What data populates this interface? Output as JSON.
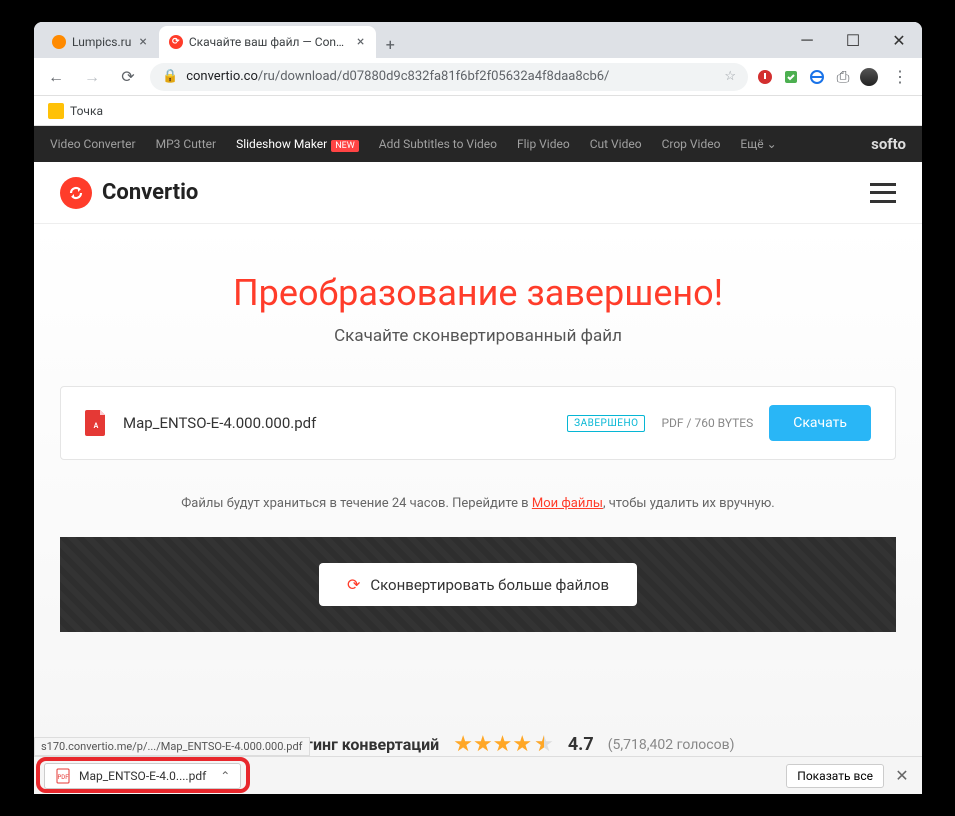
{
  "tabs": [
    {
      "title": "Lumpics.ru"
    },
    {
      "title": "Скачайте ваш файл — Convertio"
    }
  ],
  "url": {
    "host": "convertio.co",
    "path": "/ru/download/d07880d9c832fa81f6bf2f05632a4f8daa8cb6/"
  },
  "bookmark": "Точка",
  "softo_nav": {
    "items": [
      "Video Converter",
      "MP3 Cutter",
      "Slideshow Maker",
      "Add Subtitles to Video",
      "Flip Video",
      "Cut Video",
      "Crop Video",
      "Ещё"
    ],
    "new_badge": "NEW",
    "brand": "softo"
  },
  "brand": "Convertio",
  "page": {
    "h1": "Преобразование завершено!",
    "h2": "Скачайте сконвертированный файл",
    "file": {
      "name": "Map_ENTSO-E-4.000.000.pdf",
      "status": "ЗАВЕРШЕНО",
      "meta": "PDF / 760 BYTES",
      "dl": "Скачать"
    },
    "note_pre": "Файлы будут храниться в течение 24 часов. Перейдите в ",
    "note_link": "Мои файлы",
    "note_post": ", чтобы удалить их вручную.",
    "convert_more": "Сконвертировать больше файлов",
    "rating_label": "Общий рейтинг конвертаций",
    "rating_value": "4.7",
    "rating_count": "(5,718,402 голосов)"
  },
  "status_url": "s170.convertio.me/p/.../Map_ENTSO-E-4.000.000.pdf",
  "download_bar": {
    "file": "Map_ENTSO-E-4.0....pdf",
    "show_all": "Показать все"
  }
}
